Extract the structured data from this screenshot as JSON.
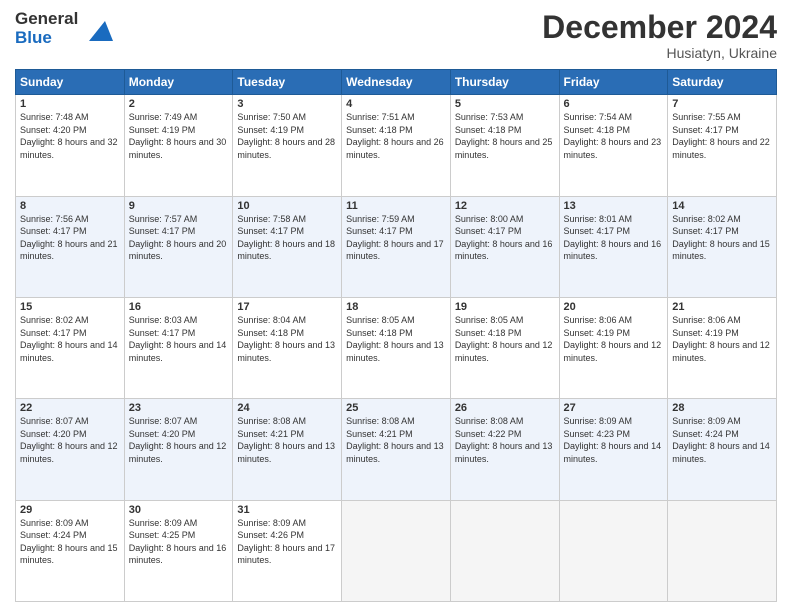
{
  "header": {
    "logo_line1": "General",
    "logo_line2": "Blue",
    "month_title": "December 2024",
    "location": "Husiatyn, Ukraine"
  },
  "days_of_week": [
    "Sunday",
    "Monday",
    "Tuesday",
    "Wednesday",
    "Thursday",
    "Friday",
    "Saturday"
  ],
  "weeks": [
    [
      {
        "num": "1",
        "sunrise": "7:48 AM",
        "sunset": "4:20 PM",
        "daylight": "8 hours and 32 minutes."
      },
      {
        "num": "2",
        "sunrise": "7:49 AM",
        "sunset": "4:19 PM",
        "daylight": "8 hours and 30 minutes."
      },
      {
        "num": "3",
        "sunrise": "7:50 AM",
        "sunset": "4:19 PM",
        "daylight": "8 hours and 28 minutes."
      },
      {
        "num": "4",
        "sunrise": "7:51 AM",
        "sunset": "4:18 PM",
        "daylight": "8 hours and 26 minutes."
      },
      {
        "num": "5",
        "sunrise": "7:53 AM",
        "sunset": "4:18 PM",
        "daylight": "8 hours and 25 minutes."
      },
      {
        "num": "6",
        "sunrise": "7:54 AM",
        "sunset": "4:18 PM",
        "daylight": "8 hours and 23 minutes."
      },
      {
        "num": "7",
        "sunrise": "7:55 AM",
        "sunset": "4:17 PM",
        "daylight": "8 hours and 22 minutes."
      }
    ],
    [
      {
        "num": "8",
        "sunrise": "7:56 AM",
        "sunset": "4:17 PM",
        "daylight": "8 hours and 21 minutes."
      },
      {
        "num": "9",
        "sunrise": "7:57 AM",
        "sunset": "4:17 PM",
        "daylight": "8 hours and 20 minutes."
      },
      {
        "num": "10",
        "sunrise": "7:58 AM",
        "sunset": "4:17 PM",
        "daylight": "8 hours and 18 minutes."
      },
      {
        "num": "11",
        "sunrise": "7:59 AM",
        "sunset": "4:17 PM",
        "daylight": "8 hours and 17 minutes."
      },
      {
        "num": "12",
        "sunrise": "8:00 AM",
        "sunset": "4:17 PM",
        "daylight": "8 hours and 16 minutes."
      },
      {
        "num": "13",
        "sunrise": "8:01 AM",
        "sunset": "4:17 PM",
        "daylight": "8 hours and 16 minutes."
      },
      {
        "num": "14",
        "sunrise": "8:02 AM",
        "sunset": "4:17 PM",
        "daylight": "8 hours and 15 minutes."
      }
    ],
    [
      {
        "num": "15",
        "sunrise": "8:02 AM",
        "sunset": "4:17 PM",
        "daylight": "8 hours and 14 minutes."
      },
      {
        "num": "16",
        "sunrise": "8:03 AM",
        "sunset": "4:17 PM",
        "daylight": "8 hours and 14 minutes."
      },
      {
        "num": "17",
        "sunrise": "8:04 AM",
        "sunset": "4:18 PM",
        "daylight": "8 hours and 13 minutes."
      },
      {
        "num": "18",
        "sunrise": "8:05 AM",
        "sunset": "4:18 PM",
        "daylight": "8 hours and 13 minutes."
      },
      {
        "num": "19",
        "sunrise": "8:05 AM",
        "sunset": "4:18 PM",
        "daylight": "8 hours and 12 minutes."
      },
      {
        "num": "20",
        "sunrise": "8:06 AM",
        "sunset": "4:19 PM",
        "daylight": "8 hours and 12 minutes."
      },
      {
        "num": "21",
        "sunrise": "8:06 AM",
        "sunset": "4:19 PM",
        "daylight": "8 hours and 12 minutes."
      }
    ],
    [
      {
        "num": "22",
        "sunrise": "8:07 AM",
        "sunset": "4:20 PM",
        "daylight": "8 hours and 12 minutes."
      },
      {
        "num": "23",
        "sunrise": "8:07 AM",
        "sunset": "4:20 PM",
        "daylight": "8 hours and 12 minutes."
      },
      {
        "num": "24",
        "sunrise": "8:08 AM",
        "sunset": "4:21 PM",
        "daylight": "8 hours and 13 minutes."
      },
      {
        "num": "25",
        "sunrise": "8:08 AM",
        "sunset": "4:21 PM",
        "daylight": "8 hours and 13 minutes."
      },
      {
        "num": "26",
        "sunrise": "8:08 AM",
        "sunset": "4:22 PM",
        "daylight": "8 hours and 13 minutes."
      },
      {
        "num": "27",
        "sunrise": "8:09 AM",
        "sunset": "4:23 PM",
        "daylight": "8 hours and 14 minutes."
      },
      {
        "num": "28",
        "sunrise": "8:09 AM",
        "sunset": "4:24 PM",
        "daylight": "8 hours and 14 minutes."
      }
    ],
    [
      {
        "num": "29",
        "sunrise": "8:09 AM",
        "sunset": "4:24 PM",
        "daylight": "8 hours and 15 minutes."
      },
      {
        "num": "30",
        "sunrise": "8:09 AM",
        "sunset": "4:25 PM",
        "daylight": "8 hours and 16 minutes."
      },
      {
        "num": "31",
        "sunrise": "8:09 AM",
        "sunset": "4:26 PM",
        "daylight": "8 hours and 17 minutes."
      },
      null,
      null,
      null,
      null
    ]
  ]
}
